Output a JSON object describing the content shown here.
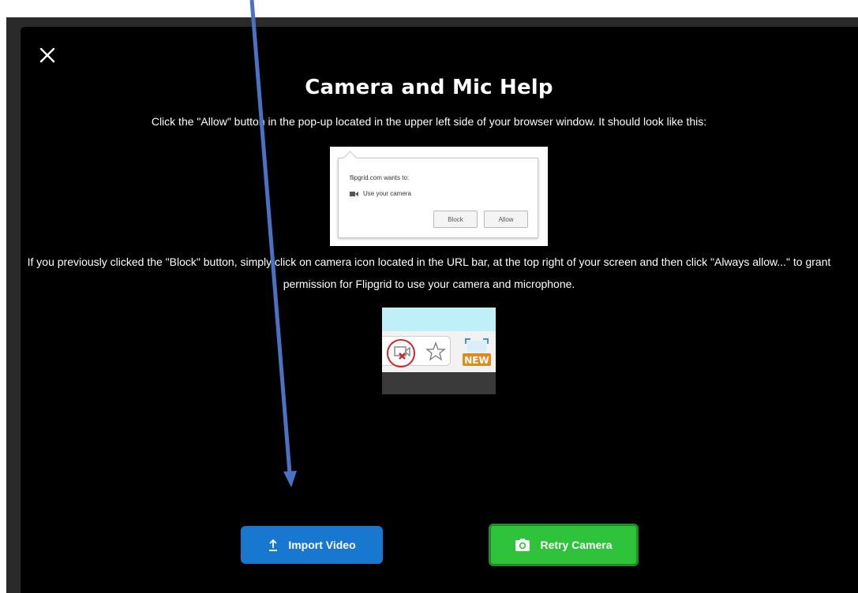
{
  "modal": {
    "title": "Camera and Mic Help",
    "instruction_1": "Click the \"Allow\" button in the pop-up located in the upper left side of your browser window. It should look like this:",
    "instruction_2": "If you previously clicked the \"Block\" button, simply click on camera icon located in the URL bar, at the top right of your screen and then click \"Always allow...\" to grant permission for Flipgrid to use your camera and microphone."
  },
  "popup_example": {
    "site": "flipgrid.com wants to:",
    "camera_label": "Use your camera",
    "block_label": "Block",
    "allow_label": "Allow"
  },
  "urlbar_example": {
    "new_badge": "NEW"
  },
  "buttons": {
    "import_label": "Import Video",
    "retry_label": "Retry Camera"
  },
  "icons": {
    "close": "close-icon",
    "upload": "upload-icon",
    "camera": "camera-icon",
    "blocked_camera": "camera-blocked-icon",
    "star": "star-icon"
  },
  "colors": {
    "modal_bg": "#000000",
    "import_button": "#1877cf",
    "retry_button": "#2ec33a",
    "annotation_arrow": "#4a72c4"
  }
}
